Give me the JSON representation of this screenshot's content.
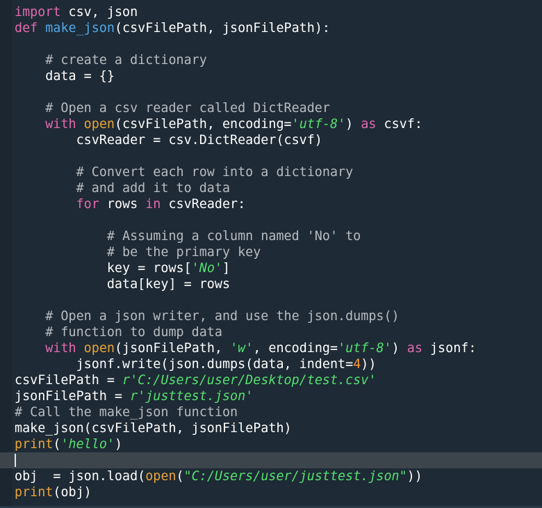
{
  "colors": {
    "background": "#1e2a35",
    "keyword": "#e36ab0",
    "builtin": "#e8a43a",
    "function_name": "#4fa8e8",
    "string": "#55e070",
    "comment": "#b8bcc2",
    "number": "#ff9a36",
    "current_line": "#3c444c"
  },
  "code": [
    [
      {
        "t": "kw",
        "v": "import"
      },
      {
        "t": "txt",
        "v": " csv, json"
      }
    ],
    [
      {
        "t": "kw",
        "v": "def"
      },
      {
        "t": "txt",
        "v": " "
      },
      {
        "t": "fn",
        "v": "make_json"
      },
      {
        "t": "txt",
        "v": "(csvFilePath, jsonFilePath):"
      }
    ],
    [],
    [
      {
        "t": "cm",
        "v": "    # create a dictionary"
      }
    ],
    [
      {
        "t": "txt",
        "v": "    data = {}"
      }
    ],
    [],
    [
      {
        "t": "cm",
        "v": "    # Open a csv reader called DictReader"
      }
    ],
    [
      {
        "t": "txt",
        "v": "    "
      },
      {
        "t": "kw",
        "v": "with"
      },
      {
        "t": "txt",
        "v": " "
      },
      {
        "t": "bi",
        "v": "open"
      },
      {
        "t": "txt",
        "v": "(csvFilePath, encoding="
      },
      {
        "t": "str",
        "v": "'utf-8'"
      },
      {
        "t": "txt",
        "v": ") "
      },
      {
        "t": "kw",
        "v": "as"
      },
      {
        "t": "txt",
        "v": " csvf:"
      }
    ],
    [
      {
        "t": "txt",
        "v": "        csvReader = csv.DictReader(csvf)"
      }
    ],
    [],
    [
      {
        "t": "cm",
        "v": "        # Convert each row into a dictionary"
      }
    ],
    [
      {
        "t": "cm",
        "v": "        # and add it to data"
      }
    ],
    [
      {
        "t": "txt",
        "v": "        "
      },
      {
        "t": "kw",
        "v": "for"
      },
      {
        "t": "txt",
        "v": " rows "
      },
      {
        "t": "kw",
        "v": "in"
      },
      {
        "t": "txt",
        "v": " csvReader:"
      }
    ],
    [],
    [
      {
        "t": "cm",
        "v": "            # Assuming a column named 'No' to"
      }
    ],
    [
      {
        "t": "cm",
        "v": "            # be the primary key"
      }
    ],
    [
      {
        "t": "txt",
        "v": "            key = rows["
      },
      {
        "t": "str",
        "v": "'No'"
      },
      {
        "t": "txt",
        "v": "]"
      }
    ],
    [
      {
        "t": "txt",
        "v": "            data[key] = rows"
      }
    ],
    [],
    [
      {
        "t": "cm",
        "v": "    # Open a json writer, and use the json.dumps()"
      }
    ],
    [
      {
        "t": "cm",
        "v": "    # function to dump data"
      }
    ],
    [
      {
        "t": "txt",
        "v": "    "
      },
      {
        "t": "kw",
        "v": "with"
      },
      {
        "t": "txt",
        "v": " "
      },
      {
        "t": "bi",
        "v": "open"
      },
      {
        "t": "txt",
        "v": "(jsonFilePath, "
      },
      {
        "t": "str",
        "v": "'w'"
      },
      {
        "t": "txt",
        "v": ", encoding="
      },
      {
        "t": "str",
        "v": "'utf-8'"
      },
      {
        "t": "txt",
        "v": ") "
      },
      {
        "t": "kw",
        "v": "as"
      },
      {
        "t": "txt",
        "v": " jsonf:"
      }
    ],
    [
      {
        "t": "txt",
        "v": "        jsonf.write(json.dumps(data, indent="
      },
      {
        "t": "num",
        "v": "4"
      },
      {
        "t": "txt",
        "v": "))"
      }
    ],
    [
      {
        "t": "txt",
        "v": "csvFilePath = "
      },
      {
        "t": "str",
        "v": "r'C:/Users/user/Desktop/test.csv'"
      }
    ],
    [
      {
        "t": "txt",
        "v": "jsonFilePath = "
      },
      {
        "t": "str",
        "v": "r'justtest.json'"
      }
    ],
    [
      {
        "t": "cm",
        "v": "# Call the make_json function"
      }
    ],
    [
      {
        "t": "txt",
        "v": "make_json(csvFilePath, jsonFilePath)"
      }
    ],
    [
      {
        "t": "bi",
        "v": "print"
      },
      {
        "t": "txt",
        "v": "("
      },
      {
        "t": "str",
        "v": "'hello'"
      },
      {
        "t": "txt",
        "v": ")"
      }
    ],
    [],
    [
      {
        "t": "txt",
        "v": "obj  = json.load("
      },
      {
        "t": "bi",
        "v": "open"
      },
      {
        "t": "txt",
        "v": "("
      },
      {
        "t": "str",
        "v": "\"C:/Users/user/justtest.json\""
      },
      {
        "t": "txt",
        "v": "))"
      }
    ],
    [
      {
        "t": "bi",
        "v": "print"
      },
      {
        "t": "txt",
        "v": "(obj)"
      }
    ]
  ],
  "current_line_index": 28
}
